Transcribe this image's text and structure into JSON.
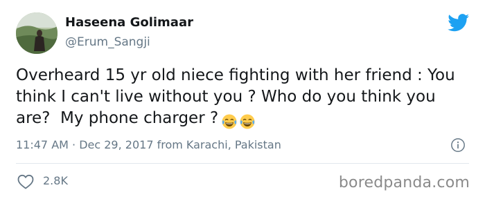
{
  "author": {
    "name": "Haseena Golimaar",
    "handle": "@Erum_Sangji",
    "avatar_icon": "profile-photo"
  },
  "platform_icon": "twitter-bird-icon",
  "tweet": {
    "text": "Overheard 15 yr old niece fighting with her friend : You think I can't live without you ? Who do you think you are?  My phone charger ?",
    "emoji": [
      "face-with-tears-of-joy",
      "face-with-tears-of-joy"
    ]
  },
  "meta": {
    "text": "11:47 AM · Dec 29, 2017 from Karachi, Pakistan",
    "info_icon": "info-icon"
  },
  "engagement": {
    "like_icon": "heart-icon",
    "likes": "2.8K"
  },
  "watermark": "boredpanda.com",
  "colors": {
    "twitter_blue": "#1da1f2",
    "secondary_text": "#657786",
    "primary_text": "#14171a",
    "divider": "#e1e8ed"
  }
}
